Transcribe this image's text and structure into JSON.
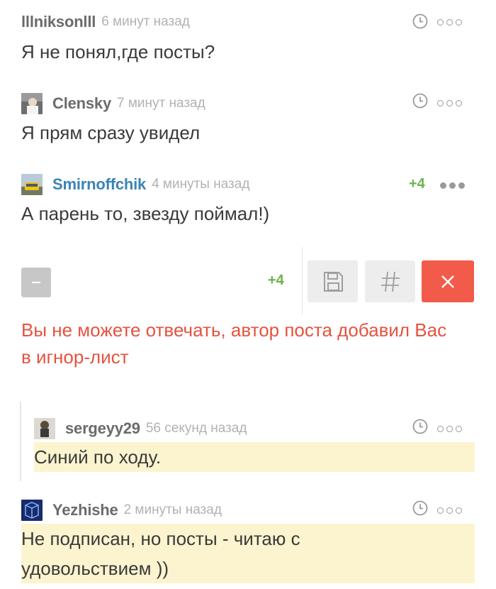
{
  "comments": [
    {
      "username": "lllniksonlll",
      "time": "6 минут назад",
      "text": "Я не понял,где посты?",
      "has_avatar": false
    },
    {
      "username": "Clensky",
      "time": "7 минут назад",
      "text": "Я прям сразу увидел",
      "has_avatar": true
    },
    {
      "username": "Smirnoffchik",
      "time": "4 минуты назад",
      "text": "А парень то, звезду поймал!)",
      "rating": "+4",
      "has_avatar": true
    },
    {
      "username": "sergeyy29",
      "time": "56 секунд назад",
      "text": "Синий по ходу.",
      "has_avatar": true,
      "highlighted": true
    },
    {
      "username": "Yezhishe",
      "time": "2 минуты назад",
      "text_lines": [
        "Не подписан, но посты - читаю с",
        "удовольствием ))"
      ],
      "has_avatar": true,
      "highlighted": true
    }
  ],
  "reply_panel": {
    "rating": "+4",
    "error_lines": [
      "Вы не можете отвечать, автор поста добавил Вас",
      "в игнор-лист"
    ],
    "buttons": [
      "minus-icon",
      "save-icon",
      "hash-icon",
      "close-icon"
    ]
  },
  "colors": {
    "rating_green": "#6cb24a",
    "error_red": "#e5533f",
    "close_red": "#f25a4a",
    "link_blue": "#3a84b6",
    "highlight": "#fcf4cf"
  }
}
